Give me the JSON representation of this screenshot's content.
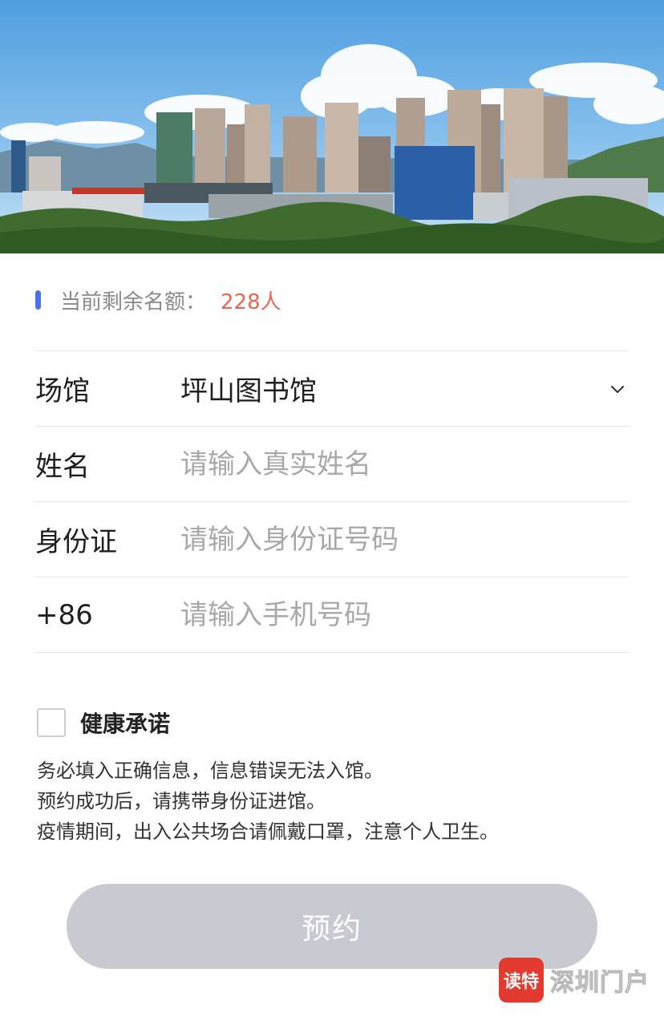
{
  "quota": {
    "label": "当前剩余名额：",
    "value": "228人"
  },
  "form": {
    "venue": {
      "label": "场馆",
      "value": "坪山图书馆"
    },
    "name": {
      "label": "姓名",
      "placeholder": "请输入真实姓名",
      "value": ""
    },
    "id_card": {
      "label": "身份证",
      "placeholder": "请输入身份证号码",
      "value": ""
    },
    "phone": {
      "label": "+86",
      "placeholder": "请输入手机号码",
      "value": ""
    }
  },
  "health": {
    "label": "健康承诺",
    "checked": false
  },
  "notes": [
    "务必填入正确信息，信息错误无法入馆。",
    "预约成功后，请携带身份证进馆。",
    "疫情期间，出入公共场合请佩戴口罩，注意个人卫生。"
  ],
  "submit": {
    "label": "预约"
  },
  "watermark": {
    "badge": "读特",
    "text": "深圳门户"
  },
  "colors": {
    "accent": "#4a74e6",
    "quota_value": "#e8654f",
    "submit_disabled": "#c9c9d1"
  }
}
